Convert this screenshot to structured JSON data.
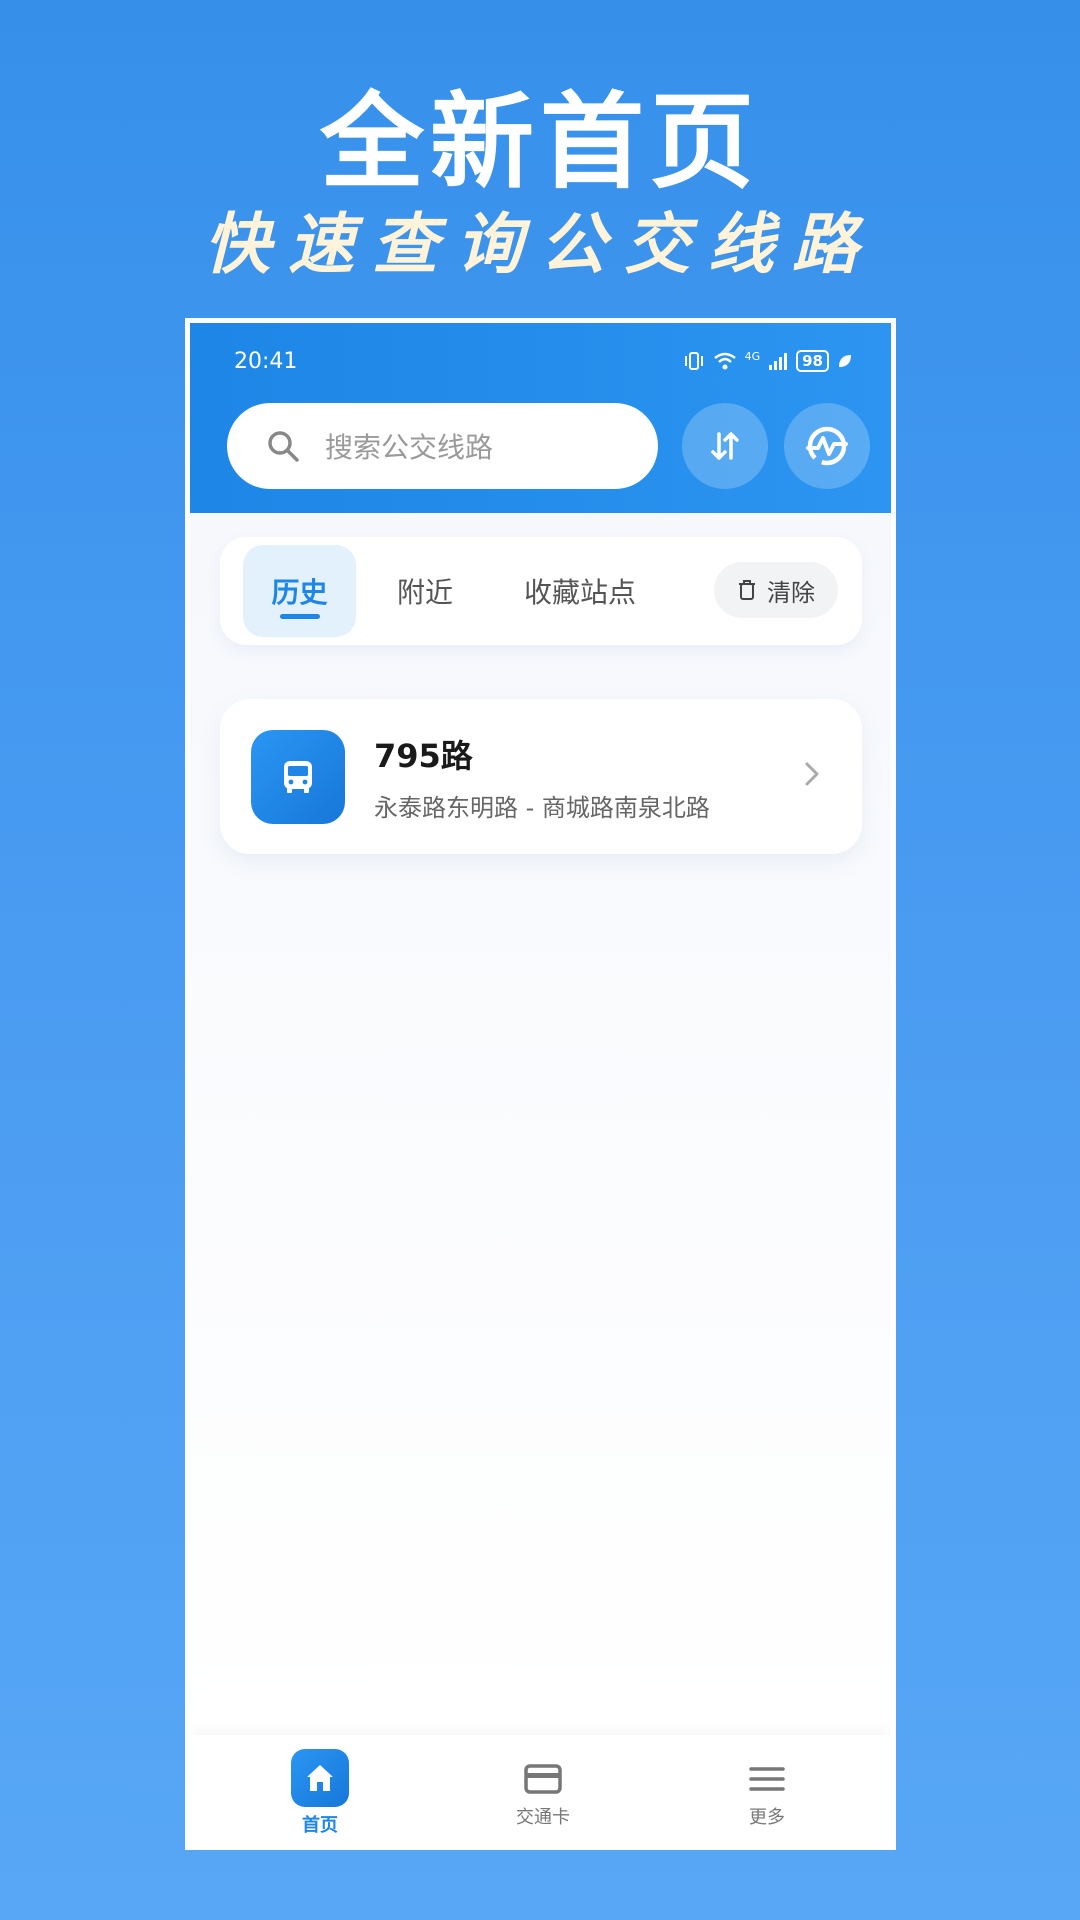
{
  "promo": {
    "title": "全新首页",
    "subtitle": "快速查询公交线路"
  },
  "status_bar": {
    "time": "20:41",
    "network": "4G",
    "battery": "98"
  },
  "search": {
    "placeholder": "搜索公交线路"
  },
  "header_buttons": [
    "swap-icon",
    "metro-icon"
  ],
  "tabs": [
    {
      "label": "历史",
      "active": true
    },
    {
      "label": "附近",
      "active": false
    },
    {
      "label": "收藏站点",
      "active": false
    }
  ],
  "clear_label": "清除",
  "history": [
    {
      "route": "795路",
      "description": "永泰路东明路 - 商城路南泉北路",
      "icon": "bus-icon"
    }
  ],
  "bottom_nav": [
    {
      "label": "首页",
      "icon": "home-icon",
      "active": true
    },
    {
      "label": "交通卡",
      "icon": "card-icon",
      "active": false
    },
    {
      "label": "更多",
      "icon": "menu-icon",
      "active": false
    }
  ],
  "colors": {
    "primary": "#1d86e6",
    "background": "#3690ea",
    "subtitle": "#fff3d9"
  }
}
